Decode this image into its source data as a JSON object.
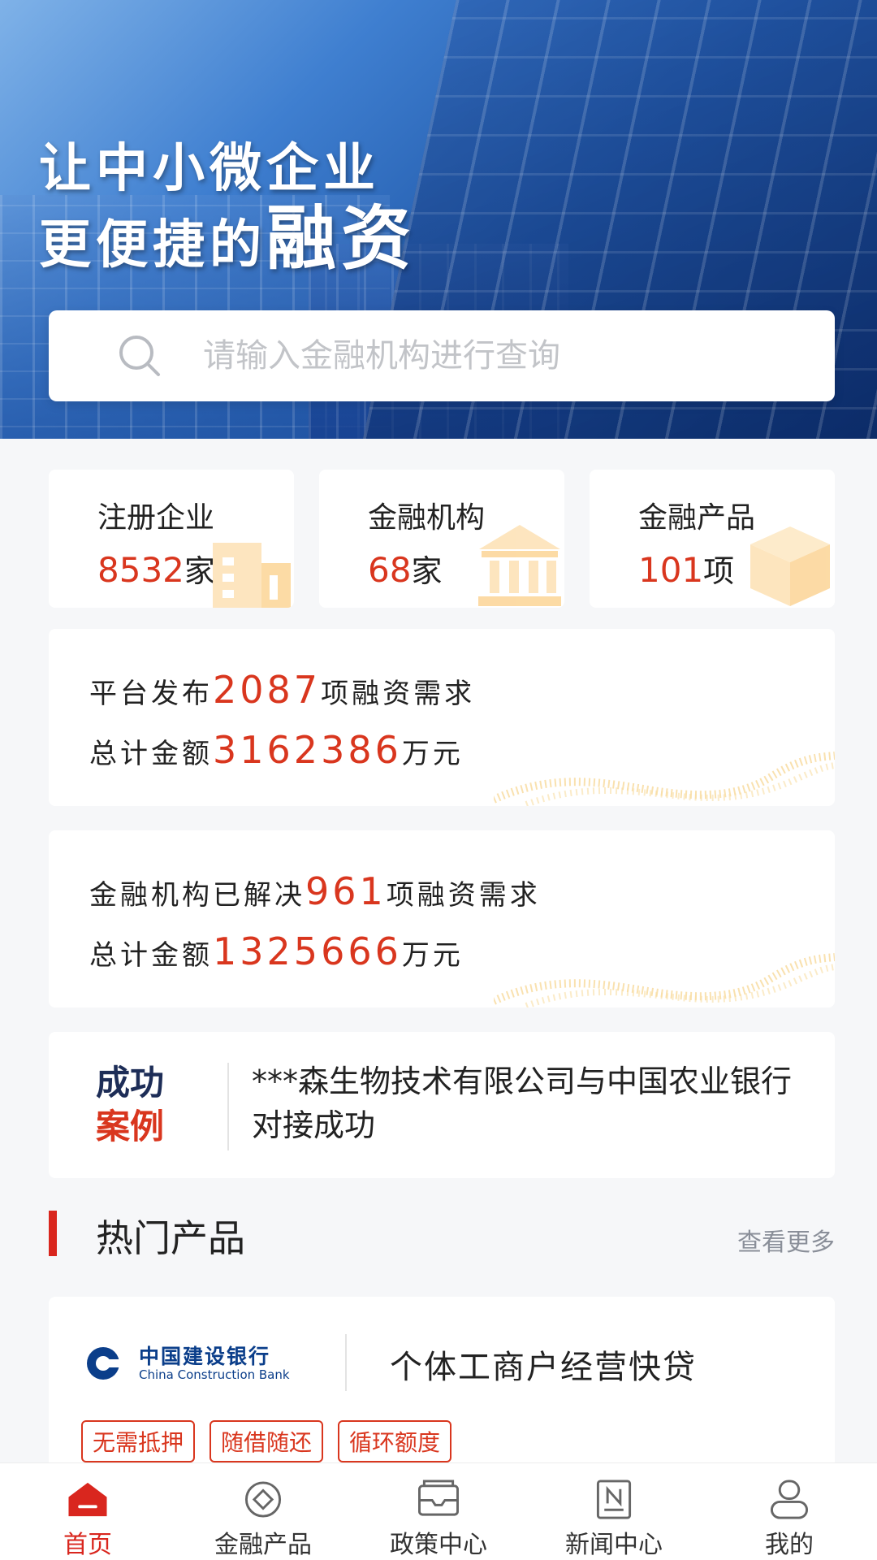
{
  "hero": {
    "line1": "让中小微企业",
    "line2_prefix": "更便捷的",
    "line2_big": "融资"
  },
  "search": {
    "placeholder": "请输入金融机构进行查询"
  },
  "stats": [
    {
      "label": "注册企业",
      "value": "8532",
      "unit": "家",
      "icon": "building-icon"
    },
    {
      "label": "金融机构",
      "value": "68",
      "unit": "家",
      "icon": "bank-icon"
    },
    {
      "label": "金融产品",
      "value": "101",
      "unit": "项",
      "icon": "box-icon"
    }
  ],
  "demand_published": {
    "line1_prefix": "平台发布",
    "line1_value": "2087",
    "line1_suffix": "项融资需求",
    "line2_prefix": "总计金额",
    "line2_value": "3162386",
    "line2_suffix": "万元"
  },
  "demand_solved": {
    "line1_prefix": "金融机构已解决",
    "line1_value": "961",
    "line1_suffix": "项融资需求",
    "line2_prefix": "总计金额",
    "line2_value": "1325666",
    "line2_suffix": "万元"
  },
  "success_case": {
    "badge_top": "成功",
    "badge_bottom": "案例",
    "text": "***森生物技术有限公司与中国农业银行对接成功"
  },
  "hot_products": {
    "title": "热门产品",
    "view_more": "查看更多",
    "items": [
      {
        "bank_cn": "中国建设银行",
        "bank_en": "China Construction Bank",
        "name": "个体工商户经营快贷",
        "tags": [
          "无需抵押",
          "随借随还",
          "循环额度"
        ]
      }
    ]
  },
  "tabbar": [
    {
      "label": "首页",
      "icon": "home-icon",
      "active": true
    },
    {
      "label": "金融产品",
      "icon": "coin-icon",
      "active": false
    },
    {
      "label": "政策中心",
      "icon": "envelope-icon",
      "active": false
    },
    {
      "label": "新闻中心",
      "icon": "news-icon",
      "active": false
    },
    {
      "label": "我的",
      "icon": "user-icon",
      "active": false
    }
  ],
  "colors": {
    "accent_red": "#d9361e",
    "navy": "#1d2d57",
    "bank_blue": "#0b3e8a"
  }
}
